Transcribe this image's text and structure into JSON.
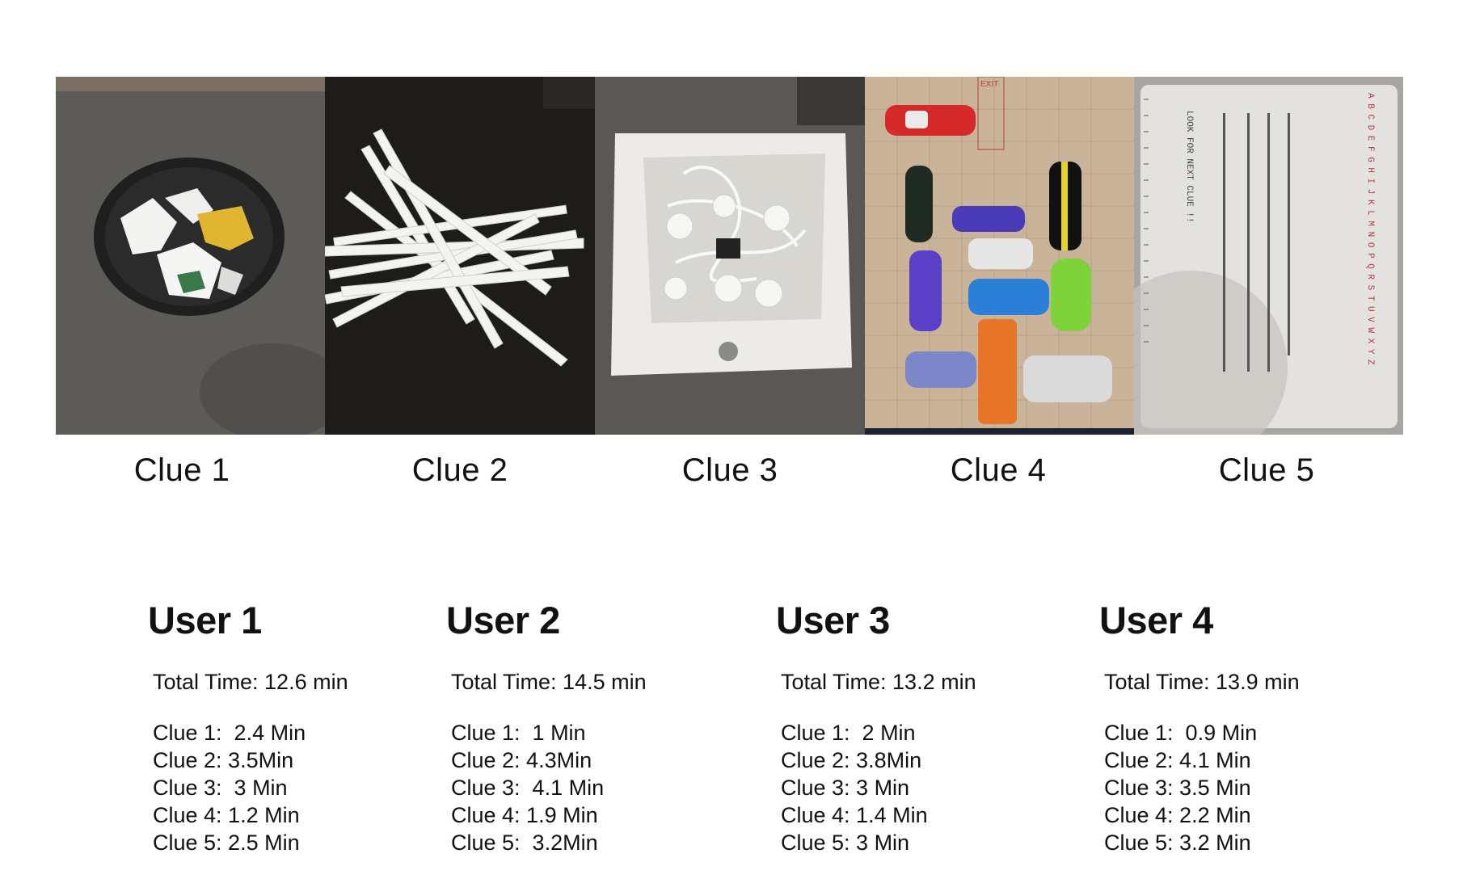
{
  "clues": [
    {
      "label": "Clue 1"
    },
    {
      "label": "Clue 2"
    },
    {
      "label": "Clue 3"
    },
    {
      "label": "Clue 4"
    },
    {
      "label": "Clue 5"
    }
  ],
  "clue4_photo": {
    "exit_sign": "EXIT"
  },
  "clue5_photo": {
    "note": "LOOK FOR NEXT CLUE !!",
    "alphabet": "A B C D E F G H I J K L M N O P Q R S T U V W X Y Z"
  },
  "users": [
    {
      "name": "User 1",
      "total": "Total Time: 12.6 min",
      "times": [
        "Clue 1:  2.4 Min",
        "Clue 2: 3.5Min",
        "Clue 3:  3 Min",
        "Clue 4: 1.2 Min",
        "Clue 5: 2.5 Min"
      ]
    },
    {
      "name": "User 2",
      "total": "Total Time: 14.5 min",
      "times": [
        "Clue 1:  1 Min",
        "Clue 2: 4.3Min",
        "Clue 3:  4.1 Min",
        "Clue 4: 1.9 Min",
        "Clue 5:  3.2Min"
      ]
    },
    {
      "name": "User 3",
      "total": "Total Time: 13.2 min",
      "times": [
        "Clue 1:  2 Min",
        "Clue 2: 3.8Min",
        "Clue 3: 3 Min",
        "Clue 4: 1.4 Min",
        "Clue 5: 3 Min"
      ]
    },
    {
      "name": "User 4",
      "total": "Total Time: 13.9 min",
      "times": [
        "Clue 1:  0.9 Min",
        "Clue 2: 4.1 Min",
        "Clue 3: 3.5 Min",
        "Clue 4: 2.2 Min",
        "Clue 5: 3.2 Min"
      ]
    }
  ]
}
